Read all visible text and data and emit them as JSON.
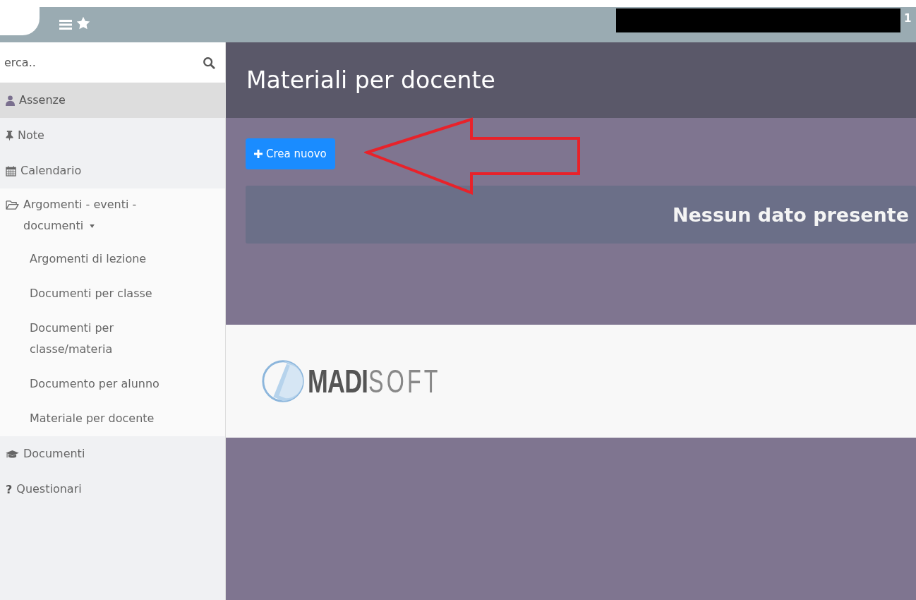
{
  "topbar": {
    "cut_text": "1"
  },
  "search": {
    "placeholder": "erca.."
  },
  "sidebar": {
    "items": [
      {
        "label": "Assenze",
        "selected": true
      },
      {
        "label": "Note",
        "selected": false
      },
      {
        "label": "Calendario",
        "selected": false
      },
      {
        "label": "Argomenti - eventi - documenti",
        "selected": false,
        "expanded": true,
        "children": [
          {
            "label": "Argomenti di lezione",
            "selected": false
          },
          {
            "label": "Documenti per classe",
            "selected": false
          },
          {
            "label": "Documenti per classe/materia",
            "selected": false
          },
          {
            "label": "Documento per alunno",
            "selected": false
          },
          {
            "label": "Materiale per docente",
            "selected": false
          }
        ]
      },
      {
        "label": "Documenti",
        "selected": false
      },
      {
        "label": "Questionari",
        "selected": false,
        "icon_text": "?"
      }
    ]
  },
  "page": {
    "title": "Materiali per docente",
    "create_button": "Crea nuovo",
    "empty_message": "Nessun dato presente"
  },
  "footer": {
    "logo_bold": "MADI",
    "logo_light": "SOFT"
  }
}
